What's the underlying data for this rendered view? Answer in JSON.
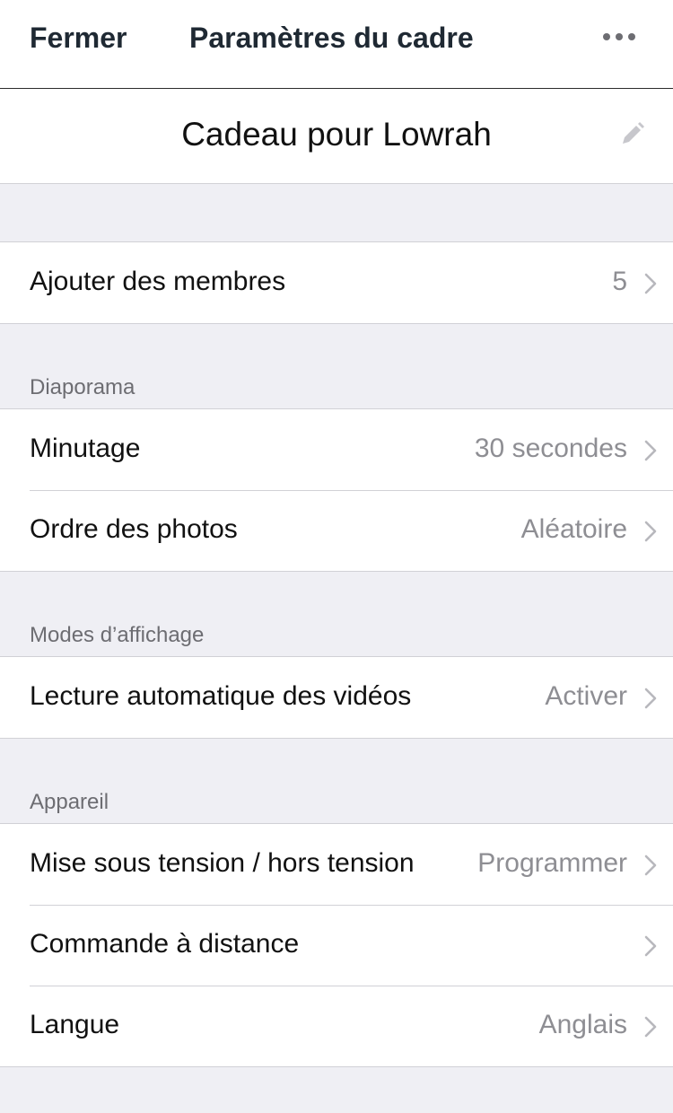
{
  "nav": {
    "close_label": "Fermer",
    "title": "Paramètres du cadre",
    "more_icon": "more-horizontal-icon"
  },
  "frame": {
    "name": "Cadeau pour Lowrah",
    "edit_icon": "pencil-icon"
  },
  "members": {
    "label": "Ajouter des membres",
    "value": "5"
  },
  "slideshow": {
    "header": "Diaporama",
    "items": [
      {
        "label": "Minutage",
        "value": "30 secondes"
      },
      {
        "label": "Ordre des photos",
        "value": "Aléatoire"
      }
    ]
  },
  "display": {
    "header": "Modes d’affichage",
    "items": [
      {
        "label": "Lecture automatique des vidéos",
        "value": "Activer"
      }
    ]
  },
  "device": {
    "header": "Appareil",
    "items": [
      {
        "label": "Mise sous tension / hors tension",
        "value": "Programmer"
      },
      {
        "label": "Commande à distance",
        "value": ""
      },
      {
        "label": "Langue",
        "value": "Anglais"
      }
    ]
  },
  "colors": {
    "background": "#efeff4",
    "value_text": "#8e8e93",
    "chevron": "#b8b8bd"
  }
}
